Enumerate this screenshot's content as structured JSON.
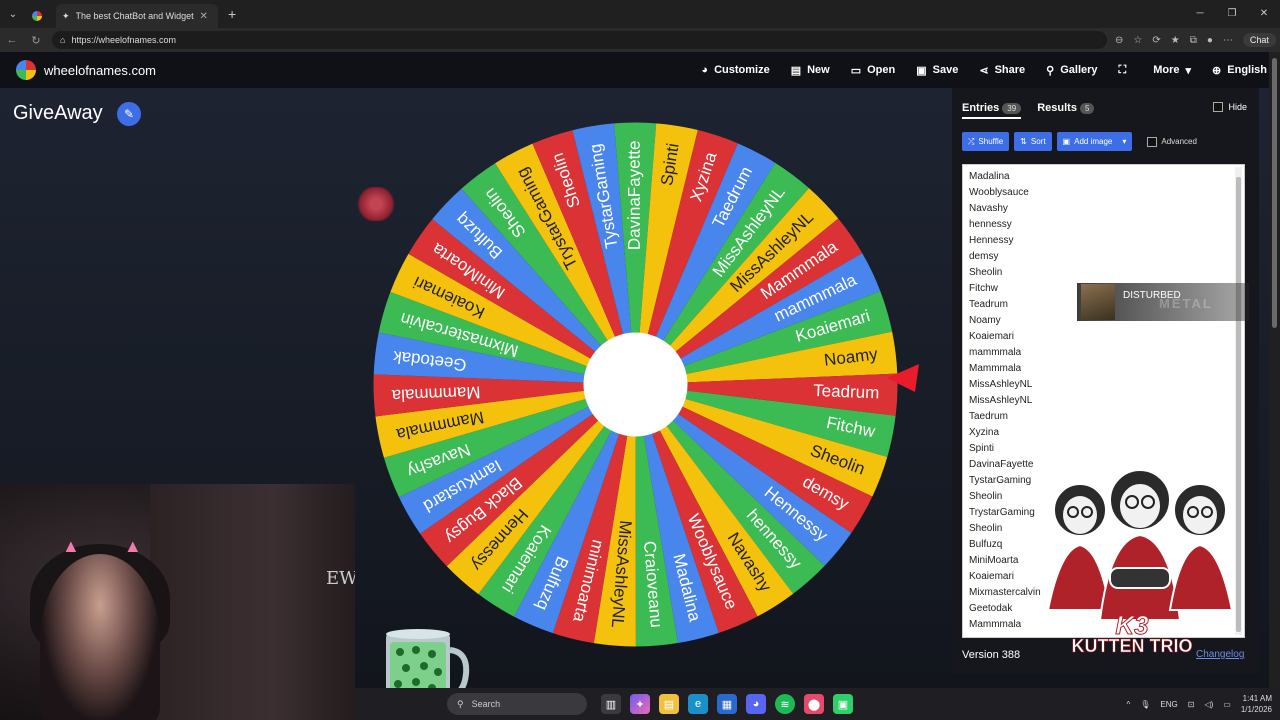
{
  "browser": {
    "tab_title": "The best ChatBot and Widgets for",
    "url": "https://wheelofnames.com",
    "chat_label": "Chat"
  },
  "site": {
    "brand": "wheelofnames.com",
    "menu": [
      {
        "label": "Customize",
        "icon": "palette-icon"
      },
      {
        "label": "New",
        "icon": "file-icon"
      },
      {
        "label": "Open",
        "icon": "folder-icon"
      },
      {
        "label": "Save",
        "icon": "save-icon"
      },
      {
        "label": "Share",
        "icon": "share-icon"
      },
      {
        "label": "Gallery",
        "icon": "search-icon"
      },
      {
        "label": "",
        "icon": "fullscreen-icon"
      },
      {
        "label": "More",
        "icon": "chevron-down-icon"
      },
      {
        "label": "English",
        "icon": "globe-icon"
      }
    ],
    "wheel_title": "GiveAway"
  },
  "wheel": {
    "colors": [
      "#3cba54",
      "#f4c20d",
      "#db3236",
      "#4885ed"
    ],
    "names": [
      "Fitchw",
      "Sheolin",
      "demsy",
      "Hennessy",
      "hennessy",
      "Navashy",
      "Wooblysauce",
      "Madalina",
      "Craioveanu",
      "MissAshleyNL",
      "minimoarta",
      "Bulfuzq",
      "Koaiemari",
      "Hennessy",
      "Black Bugsy",
      "IamKustard",
      "Navashy",
      "Mammmala",
      "Mammmala",
      "Geetodak",
      "Mixmastercalvin",
      "Koaiemari",
      "MiniMoarta",
      "Bulfuzq",
      "Sheolin",
      "TrystarGaming",
      "Sheolin",
      "TystarGaming",
      "DavinaFayette",
      "Spinti",
      "Xyzina",
      "Taedrum",
      "MissAshleyNL",
      "MissAshleyNL",
      "Mammmala",
      "mammmala",
      "Koaiemari",
      "Noamy",
      "Teadrum"
    ]
  },
  "panel": {
    "entries_label": "Entries",
    "entries_count": "39",
    "results_label": "Results",
    "results_count": "5",
    "hide_label": "Hide",
    "shuffle_label": "Shuffle",
    "sort_label": "Sort",
    "add_image_label": "Add image",
    "advanced_label": "Advanced",
    "entries": [
      "Madalina",
      "Wooblysauce",
      "Navashy",
      "hennessy",
      "Hennessy",
      "demsy",
      "Sheolin",
      "Fitchw",
      "Teadrum",
      "Noamy",
      "Koaiemari",
      "mammmala",
      "Mammmala",
      "MissAshleyNL",
      "MissAshleyNL",
      "Taedrum",
      "Xyzina",
      "Spinti",
      "DavinaFayette",
      "TystarGaming",
      "Sheolin",
      "TrystarGaming",
      "Sheolin",
      "Bulfuzq",
      "MiniMoarta",
      "Koaiemari",
      "Mixmastercalvin",
      "Geetodak",
      "Mammmala"
    ],
    "version": "Version 388",
    "changelog": "Changelog"
  },
  "overlays": {
    "now_playing": "DISTURBED",
    "now_playing_sub": "METAL",
    "webcam_wall_text": "EW.",
    "logo_line1": "K3",
    "logo_line2": "KUTTEN TRIO"
  },
  "taskbar": {
    "search_placeholder": "Search",
    "lang": "ENG",
    "time": "1:41 AM",
    "date": "1/1/2026"
  }
}
